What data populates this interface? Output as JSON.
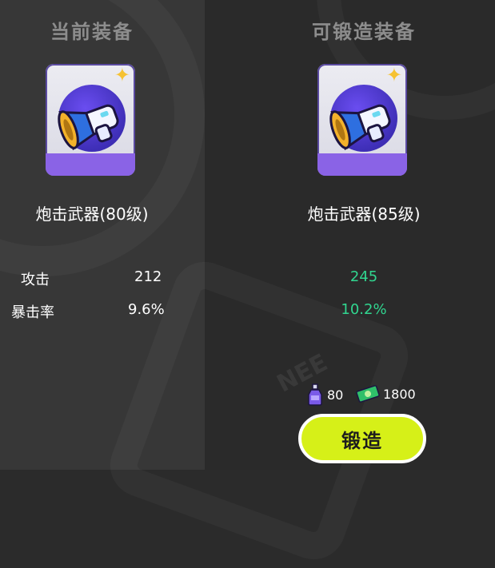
{
  "current": {
    "title": "当前装备",
    "item_name": "炮击武器(80级)",
    "stats": [
      {
        "label": "攻击",
        "value": "212"
      },
      {
        "label": "暴击率",
        "value": "9.6%"
      }
    ]
  },
  "forgeable": {
    "title": "可锻造装备",
    "item_name": "炮击武器(85级)",
    "stats": [
      {
        "value": "245"
      },
      {
        "value": "10.2%"
      }
    ]
  },
  "cost": {
    "potion_amount": "80",
    "cash_amount": "1800"
  },
  "forge_button": {
    "label": "锻造"
  },
  "colors": {
    "accent_button": "#d6f018",
    "stat_increase": "#31d690",
    "card_purple": "#8a63e6"
  },
  "icons": [
    "weapon-cannon-icon",
    "star-icon",
    "potion-bottle-icon",
    "cash-icon"
  ]
}
